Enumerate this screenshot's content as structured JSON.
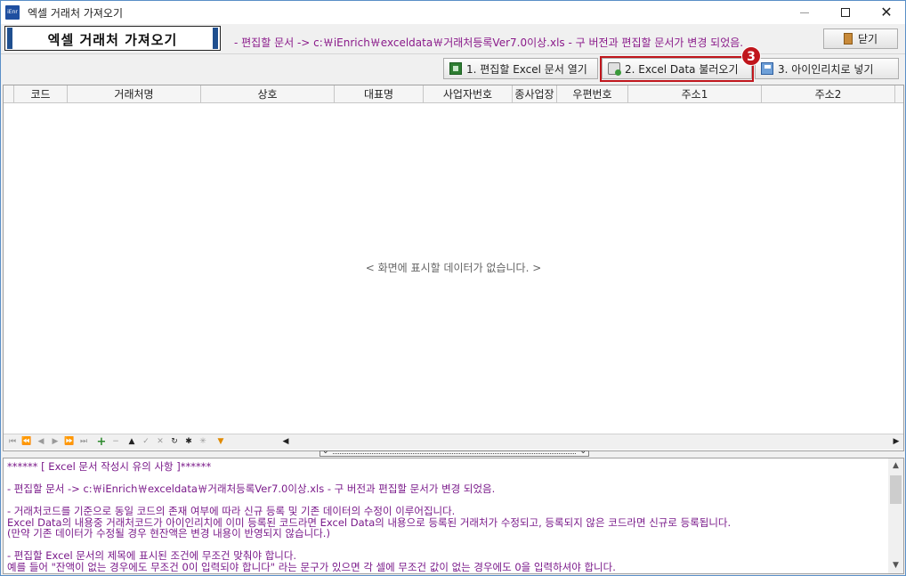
{
  "window": {
    "title": "엑셀 거래처 가져오기",
    "icon_text": "iEnr"
  },
  "header": {
    "big_title": "엑셀 거래처 가져오기",
    "note": "- 편집할 문서 -> c:￦iEnrich￦exceldata￦거래처등록Ver7.0이상.xls - 구 버전과 편집할 문서가 변경 되었음.",
    "close_label": "닫기"
  },
  "toolbar": {
    "btn_open": "1. 편집할 Excel 문서 열기",
    "btn_load": "2. Excel Data 불러오기",
    "btn_save": "3. 아이인리치로 넣기",
    "step_badge": "3"
  },
  "grid": {
    "columns": [
      "코드",
      "거래처명",
      "상호",
      "대표명",
      "사업자번호",
      "종사업장",
      "우편번호",
      "주소1",
      "주소2"
    ],
    "empty_message": "< 화면에 표시할 데이터가 없습니다. >"
  },
  "notes": {
    "lines": [
      "****** [ Excel 문서 작성시 유의 사항 ]******",
      "",
      "- 편집할 문서 -> c:￦iEnrich￦exceldata￦거래처등록Ver7.0이상.xls - 구 버전과 편집할 문서가 변경 되었음.",
      "",
      "- 거래처코드를 기준으로 동일 코드의 존재 여부에 따라 신규 등록 및 기존 데이터의 수정이 이루어집니다.",
      " Excel Data의 내용중 거래처코드가 아이인리치에 이미 등록된 코드라면 Excel Data의 내용으로 등록된 거래처가 수정되고, 등록되지 않은 코드라면 신규로 등록됩니다.",
      "(만약 기존 데이터가 수정될 경우 현잔액은 변경 내용이 반영되지 않습니다.)",
      "",
      "- 편집할 Excel 문서의 제목에 표시된 조건에 무조건 맞춰야 합니다.",
      "예를 들어 \"잔액이 없는 경우에도 무조건 0이 입력되야 합니다\" 라는 문구가 있으면 각 셀에 무조건 값이 없는 경우에도 0을 입력하셔야 합니다."
    ]
  },
  "colors": {
    "accent_red": "#c0161c",
    "note_purple": "#7a1a8a",
    "title_bar_blue": "#1f4f8f"
  }
}
